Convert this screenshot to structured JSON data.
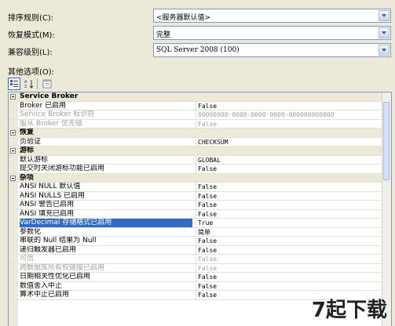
{
  "fields": [
    {
      "label": "排序规则(C):",
      "value": "<服务器默认值>"
    },
    {
      "label": "恢复模式(M):",
      "value": "完整"
    },
    {
      "label": "兼容级别(L):",
      "value": "SQL Server 2008 (100)"
    }
  ],
  "other_options_label": "其他选项(O):",
  "grid": {
    "rows": [
      {
        "type": "cat",
        "name": "Service Broker"
      },
      {
        "type": "prop",
        "name": "Broker 已启用",
        "value": "False"
      },
      {
        "type": "dis",
        "name": "Service Broker 标识符",
        "value": "00000000-0000-0000-0000-000000000000"
      },
      {
        "type": "dis",
        "name": "服从 Broker 优先级",
        "value": "False"
      },
      {
        "type": "cat",
        "name": "恢复"
      },
      {
        "type": "prop",
        "name": "页验证",
        "value": "CHECKSUM"
      },
      {
        "type": "cat",
        "name": "游标"
      },
      {
        "type": "prop",
        "name": "默认游标",
        "value": "GLOBAL"
      },
      {
        "type": "prop",
        "name": "提交时关闭游标功能已启用",
        "value": "False"
      },
      {
        "type": "cat",
        "name": "杂项"
      },
      {
        "type": "prop",
        "name": "ANSI NULL 默认值",
        "value": "False"
      },
      {
        "type": "prop",
        "name": "ANSI NULLS 已启用",
        "value": "False"
      },
      {
        "type": "prop",
        "name": "ANSI 警告已启用",
        "value": "False"
      },
      {
        "type": "prop",
        "name": "ANSI 填充已启用",
        "value": "False"
      },
      {
        "type": "sel",
        "name": "VarDecimal 存储格式已启用",
        "value": "True"
      },
      {
        "type": "prop",
        "name": "参数化",
        "value": "简单"
      },
      {
        "type": "prop",
        "name": "串联的 Null 结果为 Null",
        "value": "False"
      },
      {
        "type": "prop",
        "name": "递归触发器已启用",
        "value": "False"
      },
      {
        "type": "dis",
        "name": "可信",
        "value": "False"
      },
      {
        "type": "dis",
        "name": "跨数据库所有权链接已启用",
        "value": "False"
      },
      {
        "type": "prop",
        "name": "日期相关性优化已启用",
        "value": "False"
      },
      {
        "type": "prop",
        "name": "数值舍入中止",
        "value": "False"
      },
      {
        "type": "prop",
        "name": "算术中止已启用",
        "value": "False"
      }
    ]
  },
  "watermark": "7起下载",
  "icons": {
    "categorized": "categorized-icon",
    "alphabetical": "sort-alphabetical-icon",
    "property_pages": "property-pages-icon"
  }
}
